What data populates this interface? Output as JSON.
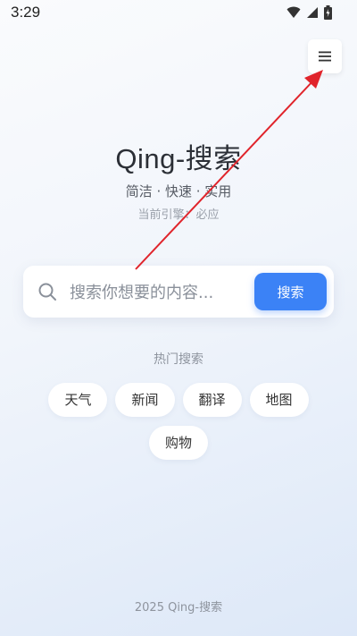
{
  "status_bar": {
    "time": "3:29",
    "icons": [
      "wifi-icon",
      "cellular-icon",
      "battery-icon"
    ]
  },
  "header": {
    "menu_icon": "☰",
    "title": "Qing-搜索",
    "subtitle": "简洁 · 快速 · 实用",
    "engine_line": "当前引擎：必应"
  },
  "search": {
    "placeholder": "搜索你想要的内容...",
    "value": "",
    "button_label": "搜索"
  },
  "hot": {
    "title": "热门搜索",
    "tags": [
      "天气",
      "新闻",
      "翻译",
      "地图",
      "购物"
    ]
  },
  "footer": {
    "text": "2025 Qing-搜索"
  },
  "colors": {
    "accent": "#3b82f6",
    "annotation_arrow": "#e0242b"
  }
}
